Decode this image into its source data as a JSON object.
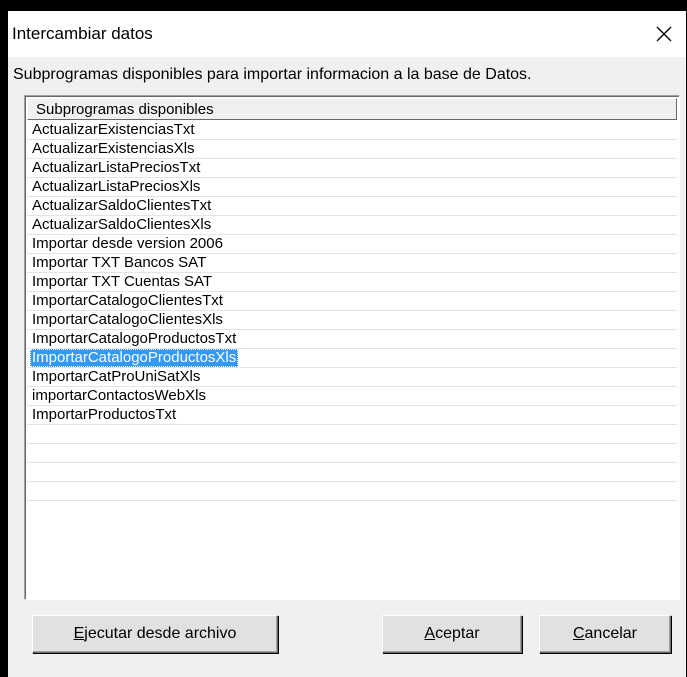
{
  "window": {
    "title": "Intercambiar datos",
    "close_icon": "close-icon"
  },
  "caption": "Subprogramas disponibles para importar informacion a la base de Datos.",
  "list": {
    "column_header": "Subprogramas disponibles",
    "selected_index": 12,
    "items": [
      "ActualizarExistenciasTxt",
      "ActualizarExistenciasXls",
      "ActualizarListaPreciosTxt",
      "ActualizarListaPreciosXls",
      "ActualizarSaldoClientesTxt",
      "ActualizarSaldoClientesXls",
      "Importar desde version 2006",
      "Importar TXT Bancos SAT",
      "Importar TXT Cuentas SAT",
      "ImportarCatalogoClientesTxt",
      "ImportarCatalogoClientesXls",
      "ImportarCatalogoProductosTxt",
      "ImportarCatalogoProductosXls",
      "ImportarCatProUniSatXls",
      "importarContactosWebXls",
      "ImportarProductosTxt"
    ],
    "empty_rows": 4
  },
  "buttons": {
    "ejecutar": {
      "accel": "E",
      "rest": "jecutar desde archivo"
    },
    "aceptar": {
      "accel": "A",
      "rest": "ceptar"
    },
    "cancelar": {
      "accel": "C",
      "rest": "ancelar"
    }
  },
  "colors": {
    "selection": "#3399ff",
    "dialog_bg": "#f0f0f0"
  }
}
